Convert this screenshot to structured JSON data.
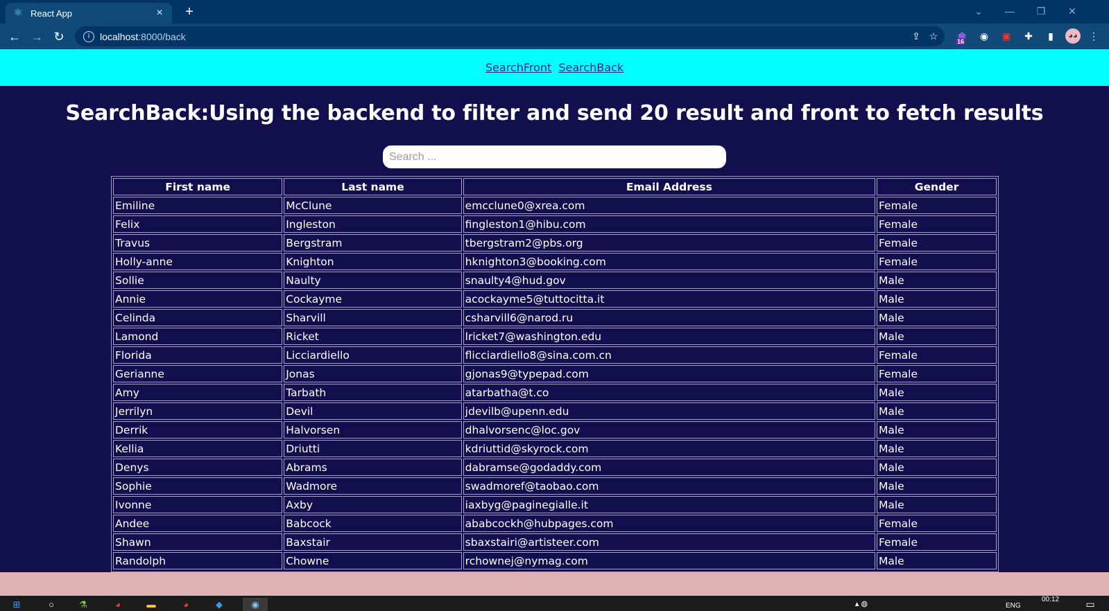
{
  "browser": {
    "tab_title": "React App",
    "url_host": "localhost",
    "url_path": ":8000/back",
    "extension_badge": "16",
    "icons": [
      "react-icon",
      "back-arrow-icon",
      "forward-arrow-icon",
      "reload-icon",
      "info-icon",
      "share-icon",
      "star-icon",
      "extension-icon",
      "puzzle-icon",
      "side-panel-icon",
      "profile-avatar-icon",
      "menu-icon"
    ]
  },
  "nav": {
    "link_front": "SearchFront",
    "link_back": "SearchBack"
  },
  "page": {
    "heading": "SearchBack:Using the backend to filter and send 20 result and front to fetch results",
    "search_placeholder": "Search ..."
  },
  "table": {
    "headers": [
      "First name",
      "Last name",
      "Email Address",
      "Gender"
    ],
    "rows": [
      [
        "Emiline",
        "McClune",
        "emcclune0@xrea.com",
        "Female"
      ],
      [
        "Felix",
        "Ingleston",
        "fingleston1@hibu.com",
        "Female"
      ],
      [
        "Travus",
        "Bergstram",
        "tbergstram2@pbs.org",
        "Female"
      ],
      [
        "Holly-anne",
        "Knighton",
        "hknighton3@booking.com",
        "Female"
      ],
      [
        "Sollie",
        "Naulty",
        "snaulty4@hud.gov",
        "Male"
      ],
      [
        "Annie",
        "Cockayme",
        "acockayme5@tuttocitta.it",
        "Male"
      ],
      [
        "Celinda",
        "Sharvill",
        "csharvill6@narod.ru",
        "Male"
      ],
      [
        "Lamond",
        "Ricket",
        "lricket7@washington.edu",
        "Male"
      ],
      [
        "Florida",
        "Licciardiello",
        "flicciardiello8@sina.com.cn",
        "Female"
      ],
      [
        "Gerianne",
        "Jonas",
        "gjonas9@typepad.com",
        "Female"
      ],
      [
        "Amy",
        "Tarbath",
        "atarbatha@t.co",
        "Male"
      ],
      [
        "Jerrilyn",
        "Devil",
        "jdevilb@upenn.edu",
        "Male"
      ],
      [
        "Derrik",
        "Halvorsen",
        "dhalvorsenc@loc.gov",
        "Male"
      ],
      [
        "Kellia",
        "Driutti",
        "kdriuttid@skyrock.com",
        "Male"
      ],
      [
        "Denys",
        "Abrams",
        "dabramse@godaddy.com",
        "Male"
      ],
      [
        "Sophie",
        "Wadmore",
        "swadmoref@taobao.com",
        "Male"
      ],
      [
        "Ivonne",
        "Axby",
        "iaxbyg@paginegialle.it",
        "Male"
      ],
      [
        "Andee",
        "Babcock",
        "ababcockh@hubpages.com",
        "Female"
      ],
      [
        "Shawn",
        "Baxstair",
        "sbaxstairi@artisteer.com",
        "Female"
      ],
      [
        "Randolph",
        "Chowne",
        "rchownej@nymag.com",
        "Male"
      ]
    ]
  },
  "taskbar": {
    "language": "ENG",
    "time": "00:12"
  },
  "colors": {
    "nav_strip": "#00ffff",
    "page_bg": "#120f4e",
    "chrome_dark": "#003566",
    "chrome_light": "#104a78",
    "below_page": "#dfb3b3"
  }
}
